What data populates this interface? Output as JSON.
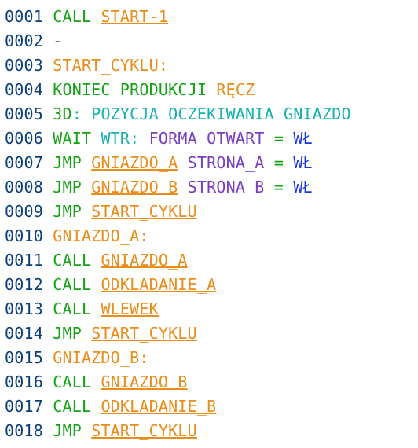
{
  "lines": [
    {
      "num": "0001",
      "tokens": [
        {
          "t": "CALL",
          "cls": "kw"
        },
        {
          "t": " "
        },
        {
          "t": "START-1",
          "cls": "link",
          "name": "link-start-1",
          "inter": true
        }
      ]
    },
    {
      "num": "0002",
      "tokens": [
        {
          "t": "-",
          "cls": "dash"
        }
      ]
    },
    {
      "num": "0003",
      "tokens": [
        {
          "t": "START_CYKLU",
          "cls": "lbl"
        },
        {
          "t": ":",
          "cls": "colon"
        }
      ]
    },
    {
      "num": "0004",
      "tokens": [
        {
          "t": "KONIEC",
          "cls": "kw"
        },
        {
          "t": " "
        },
        {
          "t": "PRODUKCJI",
          "cls": "kw"
        },
        {
          "t": " "
        },
        {
          "t": "RĘCZ",
          "cls": "lbl"
        }
      ]
    },
    {
      "num": "0005",
      "tokens": [
        {
          "t": "3D",
          "cls": "kw"
        },
        {
          "t": ":",
          "cls": "cy"
        },
        {
          "t": " "
        },
        {
          "t": "POZYCJA OCZEKIWANIA GNIAZDO",
          "cls": "cy"
        }
      ]
    },
    {
      "num": "0006",
      "tokens": [
        {
          "t": "WAIT",
          "cls": "kw"
        },
        {
          "t": " "
        },
        {
          "t": "WTR",
          "cls": "cy"
        },
        {
          "t": ":",
          "cls": "cy"
        },
        {
          "t": " "
        },
        {
          "t": "FORMA OTWART",
          "cls": "lit"
        },
        {
          "t": " "
        },
        {
          "t": "=",
          "cls": "eq"
        },
        {
          "t": " "
        },
        {
          "t": "WŁ",
          "cls": "val"
        }
      ]
    },
    {
      "num": "0007",
      "tokens": [
        {
          "t": "JMP",
          "cls": "kw"
        },
        {
          "t": " "
        },
        {
          "t": "GNIAZDO_A",
          "cls": "link",
          "name": "link-gniazdo-a",
          "inter": true
        },
        {
          "t": " "
        },
        {
          "t": "STRONA_A",
          "cls": "lit"
        },
        {
          "t": " "
        },
        {
          "t": "=",
          "cls": "eq"
        },
        {
          "t": " "
        },
        {
          "t": "WŁ",
          "cls": "val"
        }
      ]
    },
    {
      "num": "0008",
      "tokens": [
        {
          "t": "JMP",
          "cls": "kw"
        },
        {
          "t": " "
        },
        {
          "t": "GNIAZDO_B",
          "cls": "link",
          "name": "link-gniazdo-b",
          "inter": true
        },
        {
          "t": " "
        },
        {
          "t": "STRONA_B",
          "cls": "lit"
        },
        {
          "t": " "
        },
        {
          "t": "=",
          "cls": "eq"
        },
        {
          "t": " "
        },
        {
          "t": "WŁ",
          "cls": "val"
        }
      ]
    },
    {
      "num": "0009",
      "tokens": [
        {
          "t": "JMP",
          "cls": "kw"
        },
        {
          "t": " "
        },
        {
          "t": "START_CYKLU",
          "cls": "link",
          "name": "link-start-cyklu",
          "inter": true
        }
      ]
    },
    {
      "num": "0010",
      "tokens": [
        {
          "t": "GNIAZDO_A",
          "cls": "lbl"
        },
        {
          "t": ":",
          "cls": "colon"
        }
      ]
    },
    {
      "num": "0011",
      "tokens": [
        {
          "t": "CALL",
          "cls": "kw"
        },
        {
          "t": " "
        },
        {
          "t": "GNIAZDO_A",
          "cls": "link",
          "name": "link-gniazdo-a",
          "inter": true
        }
      ]
    },
    {
      "num": "0012",
      "tokens": [
        {
          "t": "CALL",
          "cls": "kw"
        },
        {
          "t": " "
        },
        {
          "t": "ODKLADANIE_A",
          "cls": "link",
          "name": "link-odkladanie-a",
          "inter": true
        }
      ]
    },
    {
      "num": "0013",
      "tokens": [
        {
          "t": "CALL",
          "cls": "kw"
        },
        {
          "t": " "
        },
        {
          "t": "WLEWEK",
          "cls": "link",
          "name": "link-wlewek",
          "inter": true
        }
      ]
    },
    {
      "num": "0014",
      "tokens": [
        {
          "t": "JMP",
          "cls": "kw"
        },
        {
          "t": " "
        },
        {
          "t": "START_CYKLU",
          "cls": "link",
          "name": "link-start-cyklu",
          "inter": true
        }
      ]
    },
    {
      "num": "0015",
      "tokens": [
        {
          "t": "GNIAZDO_B",
          "cls": "lbl"
        },
        {
          "t": ":",
          "cls": "colon"
        }
      ]
    },
    {
      "num": "0016",
      "tokens": [
        {
          "t": "CALL",
          "cls": "kw"
        },
        {
          "t": " "
        },
        {
          "t": "GNIAZDO_B",
          "cls": "link",
          "name": "link-gniazdo-b",
          "inter": true
        }
      ]
    },
    {
      "num": "0017",
      "tokens": [
        {
          "t": "CALL",
          "cls": "kw"
        },
        {
          "t": " "
        },
        {
          "t": "ODKLADANIE_B",
          "cls": "link",
          "name": "link-odkladanie-b",
          "inter": true
        }
      ]
    },
    {
      "num": "0018",
      "tokens": [
        {
          "t": "JMP",
          "cls": "kw"
        },
        {
          "t": " "
        },
        {
          "t": "START_CYKLU",
          "cls": "link",
          "name": "link-start-cyklu",
          "inter": true
        }
      ]
    }
  ]
}
